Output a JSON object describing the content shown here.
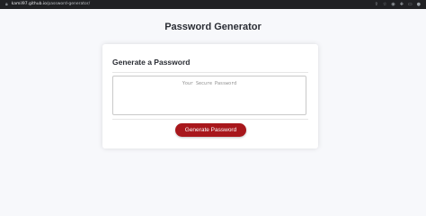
{
  "browser": {
    "url_host": "kamil97.github.io",
    "url_path": "/password-generator/",
    "icons": [
      "lock-icon",
      "share-icon",
      "star-icon",
      "extension-icon",
      "puzzle-icon",
      "window-icon",
      "profile-icon"
    ]
  },
  "header": {
    "title": "Password Generator"
  },
  "card": {
    "title": "Generate a Password",
    "password_placeholder": "Your Secure Password",
    "generate_label": "Generate Password"
  },
  "colors": {
    "accent": "#a8171c",
    "page_bg": "#f7f8fb",
    "text": "#2a2d34"
  }
}
